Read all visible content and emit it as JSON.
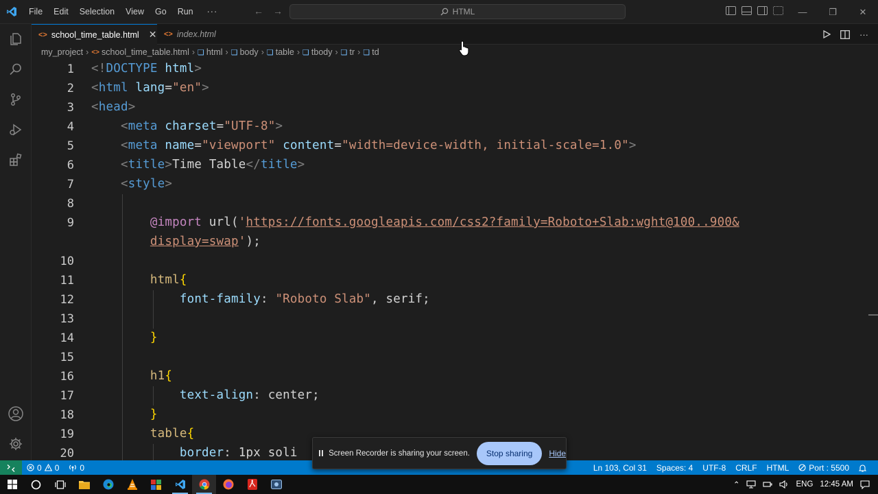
{
  "menu": [
    "File",
    "Edit",
    "Selection",
    "View",
    "Go",
    "Run",
    "···"
  ],
  "search": {
    "text": "HTML"
  },
  "tabs": [
    {
      "label": "school_time_table.html",
      "active": true
    },
    {
      "label": "index.html",
      "active": false
    }
  ],
  "breadcrumb": [
    "my_project",
    "school_time_table.html",
    "html",
    "body",
    "table",
    "tbody",
    "tr",
    "td"
  ],
  "code": {
    "line_numbers": [
      "1",
      "2",
      "3",
      "4",
      "5",
      "6",
      "7",
      "8",
      "9",
      "",
      "10",
      "11",
      "12",
      "13",
      "14",
      "15",
      "16",
      "17",
      "18",
      "19",
      "20"
    ],
    "doctype": {
      "open": "<!",
      "kw": "DOCTYPE",
      "name": "html",
      "close": ">"
    },
    "html_tag": {
      "open": "<",
      "name": "html",
      "attr": "lang",
      "eq": "=",
      "val": "\"en\"",
      "close": ">"
    },
    "head_tag": {
      "open": "<",
      "name": "head",
      "close": ">"
    },
    "meta1": {
      "open": "<",
      "name": "meta",
      "attr": "charset",
      "eq": "=",
      "val": "\"UTF-8\"",
      "close": ">"
    },
    "meta2": {
      "open": "<",
      "name": "meta",
      "attr1": "name",
      "eq1": "=",
      "val1": "\"viewport\"",
      "attr2": "content",
      "eq2": "=",
      "val2": "\"width=device-width, initial-scale=1.0\"",
      "close": ">"
    },
    "title": {
      "open": "<",
      "name": "title",
      "close": ">",
      "text": "Time Table",
      "end_open": "</",
      "end_close": ">"
    },
    "style_tag": {
      "open": "<",
      "name": "style",
      "close": ">"
    },
    "import": {
      "kw": "@import",
      "fn": "url(",
      "q1": "'",
      "url1": "https://fonts.googleapis.com/css2?family=Roboto+Slab:wght@100..900&",
      "url2": "display=swap",
      "q2": "'",
      "end": ");"
    },
    "html_rule": {
      "sel": "html",
      "open": "{",
      "prop": "font-family",
      "colon": ": ",
      "val": "\"Roboto Slab\"",
      "rest": ", serif;",
      "close": "}"
    },
    "h1_rule": {
      "sel": "h1",
      "open": "{",
      "prop": "text-align",
      "colon": ": ",
      "val": "center;",
      "close": "}"
    },
    "table_rule": {
      "sel": "table",
      "open": "{",
      "prop": "border",
      "colon": ": ",
      "val": "1px soli"
    }
  },
  "statusbar": {
    "errors": "0",
    "warnings": "0",
    "ports": "0",
    "position": "Ln 103, Col 31",
    "spaces": "Spaces: 4",
    "encoding": "UTF-8",
    "eol": "CRLF",
    "language": "HTML",
    "port": "Port : 5500"
  },
  "share": {
    "message": "Screen Recorder is sharing your screen.",
    "stop_label": "Stop sharing",
    "hide_label": "Hide"
  },
  "tray": {
    "lang": "ENG",
    "time": "12:45 AM"
  },
  "colors": {
    "statusbar": "#007acc",
    "remote": "#16825d",
    "accent": "#0078d4",
    "background": "#1e1e1e"
  }
}
